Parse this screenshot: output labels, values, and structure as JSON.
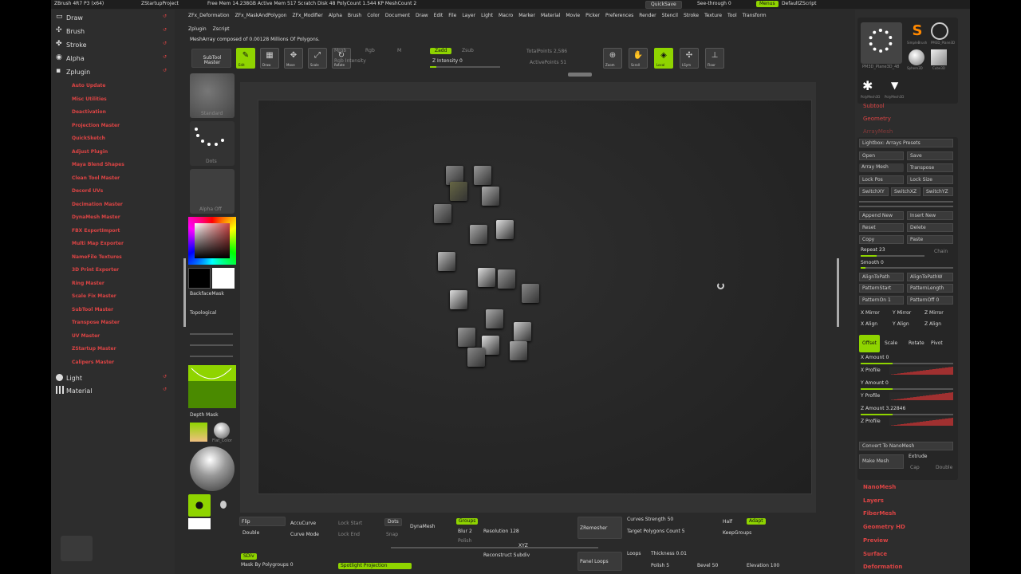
{
  "titlebar": {
    "app": "ZBrush 4R7 P3 (x64)",
    "project": "ZStartupProject",
    "stats": "Free Mem 14.238GB  Active Mem 517  Scratch Disk 48  PolyCount 1.544 KP  MeshCount 2",
    "quicksave": "QuickSave",
    "seethrough": "See-through 0",
    "menus_btn": "Menus",
    "script": "DefaultZScript"
  },
  "menubar": [
    "ZFx_Deformation",
    "ZFx_MaskAndPolygon",
    "ZFx_Modifier",
    "Alpha",
    "Brush",
    "Color",
    "Document",
    "Draw",
    "Edit",
    "File",
    "Layer",
    "Light",
    "Macro",
    "Marker",
    "Material",
    "Movie",
    "Picker",
    "Preferences",
    "Render",
    "Stencil",
    "Stroke",
    "Texture",
    "Tool",
    "Transform"
  ],
  "menubar2": [
    "Zplugin",
    "Zscript"
  ],
  "status": "MeshArray composed of 0.00128 Millions Of Polygons.",
  "left_palette": {
    "headers": [
      "Draw",
      "Brush",
      "Stroke",
      "Alpha",
      "Zplugin"
    ],
    "plugins": [
      "Auto Update",
      "Misc Utilities",
      "Deactivation",
      "Projection Master",
      "QuickSketch",
      "Adjust Plugin",
      "Maya Blend Shapes",
      "Clean Tool Master",
      "Decord UVs",
      "Decimation Master",
      "DynaMesh Master",
      "FBX ExportImport",
      "Multi Map Exporter",
      "NameFile Textures",
      "3D Print Exporter",
      "Ring Master",
      "Scale Fix Master",
      "SubTool Master",
      "Transpose Master",
      "UV Master",
      "ZStartup Master",
      "Calipers Master"
    ],
    "footer": [
      "Light",
      "Material"
    ]
  },
  "toolbar": {
    "subtool_master": "SubTool Master",
    "buttons": [
      "Edit",
      "Draw",
      "Move",
      "Scale",
      "Rotate"
    ],
    "mrgb": "Mrgb",
    "rgb": "Rgb",
    "m": "M",
    "zadd": "Zadd",
    "zsub": "Zsub",
    "rgb_intensity": "Rgb Intensity",
    "z_intensity": "Z Intensity 0",
    "total_points": "TotalPoints 2,586",
    "active_points": "ActivePoints 51",
    "right": [
      "Zoom",
      "Scroll",
      "Local",
      "LSym",
      "Floor"
    ]
  },
  "shelf": {
    "brush": "Standard",
    "stroke": "Dots",
    "alpha": "Alpha Off",
    "backface": "BackfaceMask",
    "topological": "Topological",
    "depth_mask": "Depth Mask",
    "mat": "MatCap",
    "flat": "Flat_Color"
  },
  "right_tray": {
    "top": [
      "PM3D_Plane3D_48",
      "SimpleBrush",
      "PM3D_Plane3D",
      "Sphere3D",
      "Cube3D",
      "PolyMesh3D",
      "PolyMesh3D"
    ],
    "sections": [
      "Subtool",
      "Geometry",
      "ArrayMesh"
    ],
    "panel_title": "Lightbox: Arrays Presets",
    "open": "Open",
    "save": "Save",
    "array_mesh": "Array Mesh",
    "transpose": "Transpose",
    "lock_pos": "Lock Pos",
    "lock_size": "Lock Size",
    "switches": [
      "SwitchXY",
      "SwitchXZ",
      "SwitchYZ"
    ],
    "append": "Append New",
    "insert": "Insert New",
    "reset": "Reset",
    "delete": "Delete",
    "copy": "Copy",
    "paste": "Paste",
    "repeat": "Repeat 23",
    "chain": "Chain",
    "smooth": "Smooth 0",
    "align_path": "AlignToPath",
    "align_path_wrap": "AlignToPathW",
    "pattern_start": "PatternStart",
    "pattern_length": "PatternLength",
    "pattern_on": "PatternOn 1",
    "pattern_off": "PatternOff 0",
    "mirrors": [
      "X Mirror",
      "Y Mirror",
      "Z Mirror"
    ],
    "aligns": [
      "X Align",
      "Y Align",
      "Z Align"
    ],
    "tabs": [
      "Offset",
      "Scale",
      "Rotate",
      "Pivot"
    ],
    "amounts": [
      "X Amount 0",
      "X Profile",
      "Y Amount 0",
      "Y Profile",
      "Z Amount 3.22846",
      "Z Profile"
    ],
    "convert": "Convert To NanoMesh",
    "make_mesh": "Make Mesh",
    "extrude": "Extrude",
    "cap": "Cap",
    "double": "Double",
    "bottom": [
      "NanoMesh",
      "Layers",
      "FiberMesh",
      "Geometry HD",
      "Preview",
      "Surface",
      "Deformation"
    ]
  },
  "bottom": {
    "r1": [
      "Flip",
      "Double",
      "AccuCurve",
      "Curve Mode",
      "Lock Start",
      "Lock End",
      "Dots",
      "Snap",
      "DynaMesh",
      "Groups",
      "Blur 2",
      "Polish",
      "Resolution 128",
      "ZRemesher",
      "Curves Strength 50",
      "Target Polygons Count 5",
      "Half",
      "Adapt",
      "KeepGroups"
    ],
    "r2": [
      "SDiv",
      "Mask By Polygroups 0",
      "Spotlight Projection",
      "Reconstruct Subdiv",
      "Panel Loops",
      "Loops",
      "Thickness 0.01",
      "Polish 5",
      "Bevel 50",
      "Elevation 100"
    ],
    "mid": "XYZ"
  }
}
